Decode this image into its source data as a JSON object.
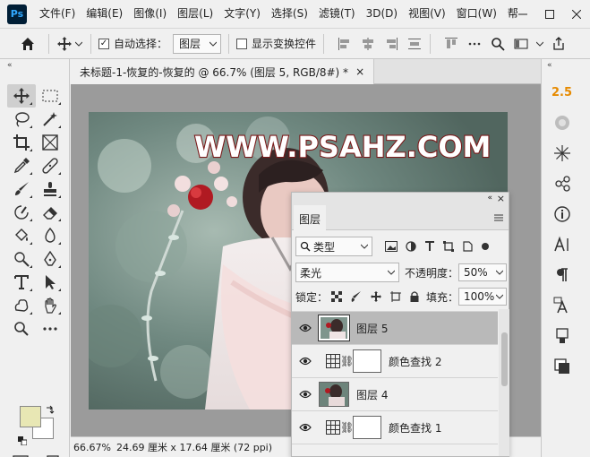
{
  "menubar": {
    "logo": "Ps",
    "items": [
      "文件(F)",
      "编辑(E)",
      "图像(I)",
      "图层(L)",
      "文字(Y)",
      "选择(S)",
      "滤镜(T)",
      "3D(D)",
      "视图(V)",
      "窗口(W)",
      "帮"
    ],
    "window_controls": [
      "minimize-icon",
      "maximize-icon",
      "close-icon"
    ]
  },
  "options": {
    "auto_select_label": "自动选择：",
    "auto_select_checked": true,
    "auto_select_value": "图层",
    "transform_label": "显示变换控件",
    "transform_checked": false
  },
  "document": {
    "tab_title": "未标题-1-恢复的-恢复的 @ 66.7% (图层 5, RGB/8#) *",
    "tab_close": "×",
    "watermark": "WWW.PSAHZ.COM"
  },
  "status": {
    "zoom": "66.67%",
    "doc_size": "24.69 厘米 x 17.64 厘米 (72 ppi)"
  },
  "colors": {
    "foreground": "#e8e7b4",
    "background": "#ffffff",
    "version_badge": "#e68a00"
  },
  "rightdock": {
    "version_label": "2.5"
  },
  "layers_panel": {
    "tab_label": "图层",
    "filter_label": "类型",
    "blend_mode": "柔光",
    "opacity_label": "不透明度：",
    "opacity_value": "50%",
    "lock_label": "锁定：",
    "fill_label": "填充：",
    "fill_value": "100%",
    "layers": [
      {
        "name": "图层 5",
        "type": "image",
        "selected": true
      },
      {
        "name": "颜色查找 2",
        "type": "adjustment",
        "selected": false
      },
      {
        "name": "图层 4",
        "type": "image",
        "selected": false
      },
      {
        "name": "颜色查找 1",
        "type": "adjustment",
        "selected": false
      }
    ]
  }
}
